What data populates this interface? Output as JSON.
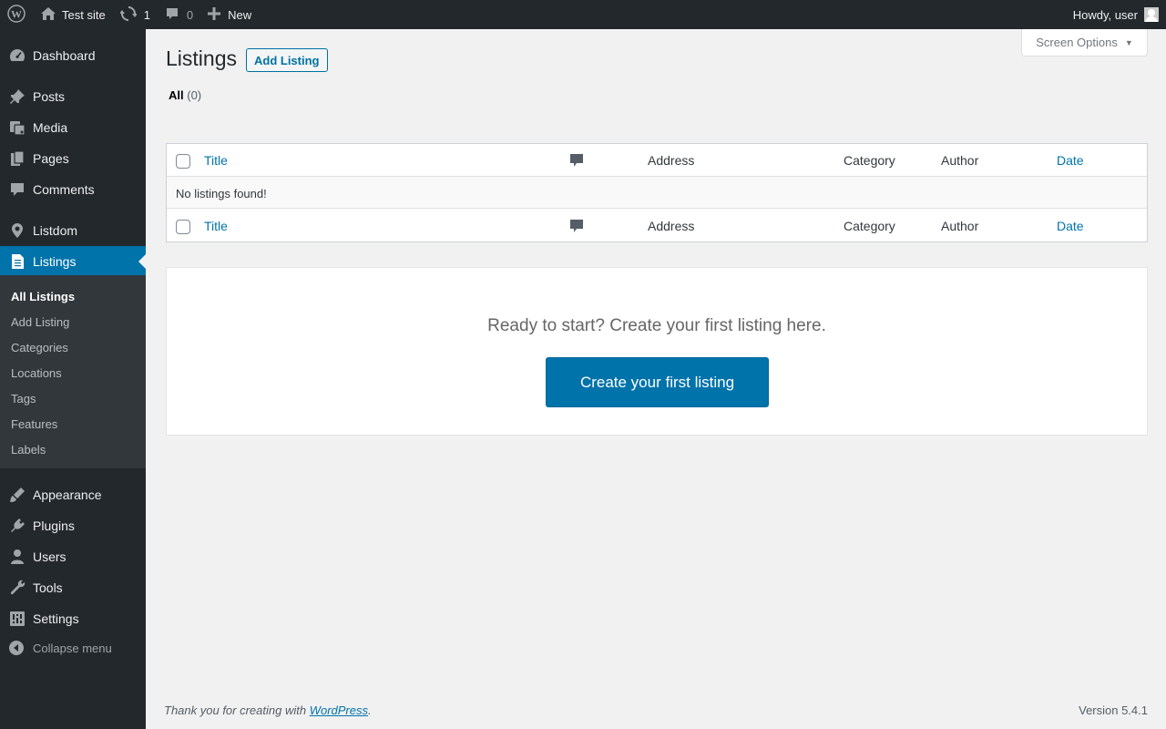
{
  "adminbar": {
    "site_name": "Test site",
    "updates_count": "1",
    "comments_count": "0",
    "new_label": "New",
    "howdy": "Howdy, user"
  },
  "sidebar": {
    "items": [
      {
        "label": "Dashboard",
        "icon": "dashboard-icon"
      },
      {
        "label": "Posts",
        "icon": "pin-icon"
      },
      {
        "label": "Media",
        "icon": "media-icon"
      },
      {
        "label": "Pages",
        "icon": "pages-icon"
      },
      {
        "label": "Comments",
        "icon": "comment-icon"
      },
      {
        "label": "Listdom",
        "icon": "location-pin-icon"
      },
      {
        "label": "Listings",
        "icon": "document-icon"
      },
      {
        "label": "Appearance",
        "icon": "brush-icon"
      },
      {
        "label": "Plugins",
        "icon": "plug-icon"
      },
      {
        "label": "Users",
        "icon": "user-icon"
      },
      {
        "label": "Tools",
        "icon": "wrench-icon"
      },
      {
        "label": "Settings",
        "icon": "sliders-icon"
      }
    ],
    "submenu": [
      "All Listings",
      "Add Listing",
      "Categories",
      "Locations",
      "Tags",
      "Features",
      "Labels"
    ],
    "collapse_label": "Collapse menu"
  },
  "main": {
    "screen_options": "Screen Options",
    "page_title": "Listings",
    "add_button": "Add Listing",
    "filter_all": "All",
    "filter_count": "(0)",
    "table": {
      "columns": [
        "Title",
        "Address",
        "Category",
        "Author",
        "Date"
      ],
      "empty": "No listings found!"
    },
    "empty_state": {
      "message": "Ready to start? Create your first listing here.",
      "button": "Create your first listing"
    }
  },
  "footer": {
    "thanks_prefix": "Thank you for creating with ",
    "thanks_link": "WordPress",
    "thanks_suffix": ".",
    "version": "Version 5.4.1"
  },
  "colors": {
    "adminbar": "#23282d",
    "sidebar_submenu": "#32373c",
    "accent": "#0073aa",
    "background": "#f1f1f1"
  }
}
